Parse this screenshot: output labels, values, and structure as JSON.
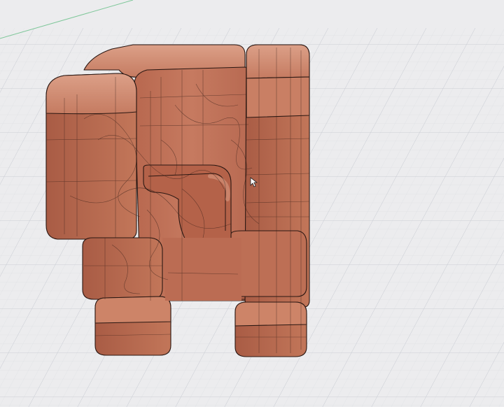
{
  "viewport": {
    "background": "#ececee",
    "grid_minor_color": "#d9dbe0",
    "grid_major_color": "#c9ccd3",
    "axis_color": "#7fc79a"
  },
  "model": {
    "fill_color": "#c4775e",
    "fill_light": "#d99a80",
    "fill_shadow": "#9e5844",
    "edge_color": "#2a1712",
    "display_mode": "shaded-with-edges"
  },
  "cursor": {
    "icon": "arrow-cursor-icon"
  }
}
